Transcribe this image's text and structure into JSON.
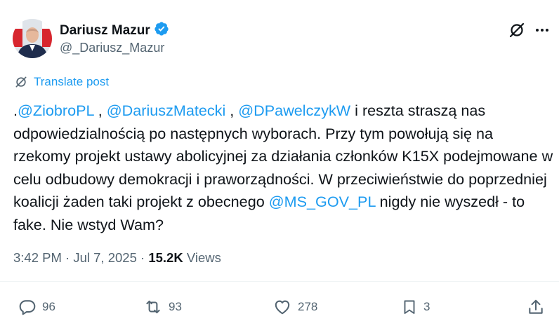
{
  "author": {
    "name": "Dariusz Mazur",
    "handle": "@_Dariusz_Mazur",
    "verified": true
  },
  "translate_label": "Translate post",
  "post": {
    "prefix": ".",
    "mention1": "@ZiobroPL",
    "sep1": " , ",
    "mention2": "@DariuszMatecki",
    "sep2": " , ",
    "mention3": "@DPawelczykW",
    "text1": " i reszta straszą nas odpowiedzialnością po następnych wyborach. Przy tym powołują się na rzekomy projekt ustawy abolicyjnej za działania członków K15X podejmowane w celu odbudowy demokracji i praworządności. W przeciwieństwie do poprzedniej koalicji żaden taki projekt z obecnego ",
    "mention4": "@MS_GOV_PL",
    "text2": " nigdy nie wyszedł - to fake. Nie wstyd Wam?"
  },
  "meta": {
    "time": "3:42 PM",
    "sep": " · ",
    "date": "Jul 7, 2025",
    "sep2": " · ",
    "views_count": "15.2K",
    "views_label": " Views"
  },
  "actions": {
    "replies": "96",
    "reposts": "93",
    "likes": "278",
    "bookmarks": "3"
  },
  "colors": {
    "accent": "#1d9bf0",
    "text": "#0f1419",
    "muted": "#536471"
  }
}
